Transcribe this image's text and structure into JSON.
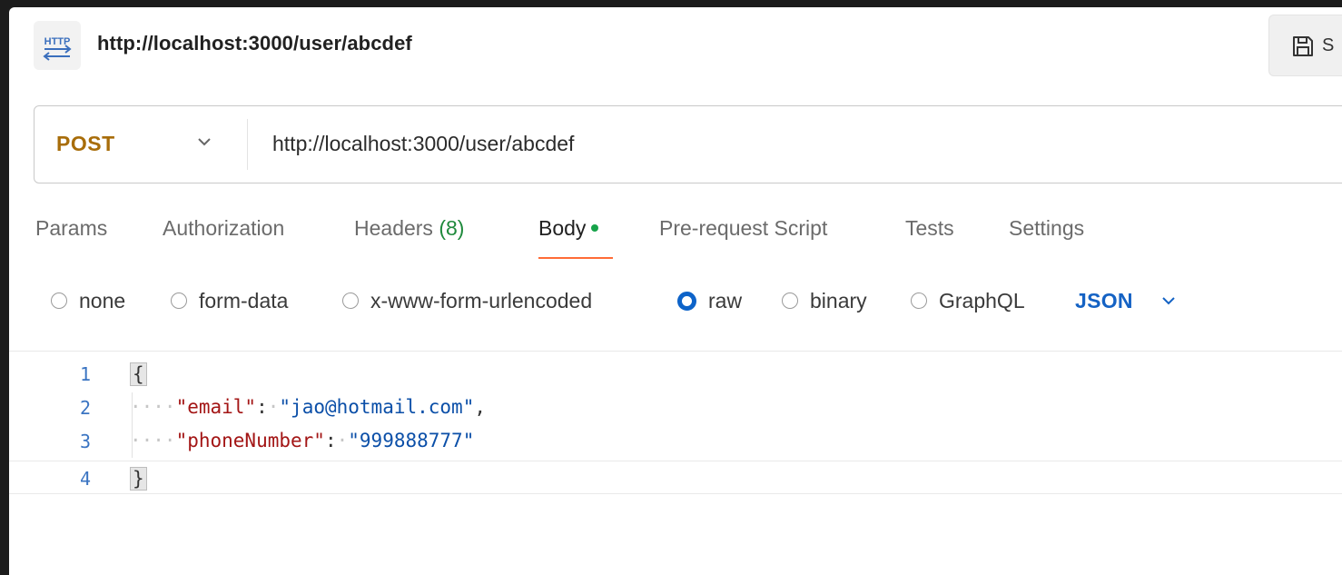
{
  "header": {
    "icon": "http-icon",
    "icon_text": "HTTP",
    "title": "http://localhost:3000/user/abcdef",
    "save_icon": "save-icon",
    "save_label": "S"
  },
  "request": {
    "method": "POST",
    "url": "http://localhost:3000/user/abcdef"
  },
  "tabs": [
    {
      "label": "Params"
    },
    {
      "label": "Authorization"
    },
    {
      "label": "Headers",
      "count": "(8)"
    },
    {
      "label": "Body",
      "active": true,
      "has_dot": true
    },
    {
      "label": "Pre-request Script"
    },
    {
      "label": "Tests"
    },
    {
      "label": "Settings"
    }
  ],
  "body_types": [
    {
      "label": "none",
      "selected": false
    },
    {
      "label": "form-data",
      "selected": false
    },
    {
      "label": "x-www-form-urlencoded",
      "selected": false
    },
    {
      "label": "raw",
      "selected": true
    },
    {
      "label": "binary",
      "selected": false
    },
    {
      "label": "GraphQL",
      "selected": false
    }
  ],
  "format": {
    "label": "JSON"
  },
  "editor": {
    "line_numbers": [
      "1",
      "2",
      "3",
      "4"
    ],
    "open_brace": "{",
    "close_brace": "}",
    "indent": "····",
    "fields": [
      {
        "key": "\"email\"",
        "value": "\"jao@hotmail.com\"",
        "trailing": ","
      },
      {
        "key": "\"phoneNumber\"",
        "value": "\"999888777\"",
        "trailing": ""
      }
    ]
  },
  "colors": {
    "method": "#a86d0a",
    "accent_tab": "#ff6c37",
    "radio_selected": "#0d63c9",
    "json_key": "#a31515",
    "json_string": "#0b4fa8",
    "status_dot": "#16a34a"
  }
}
